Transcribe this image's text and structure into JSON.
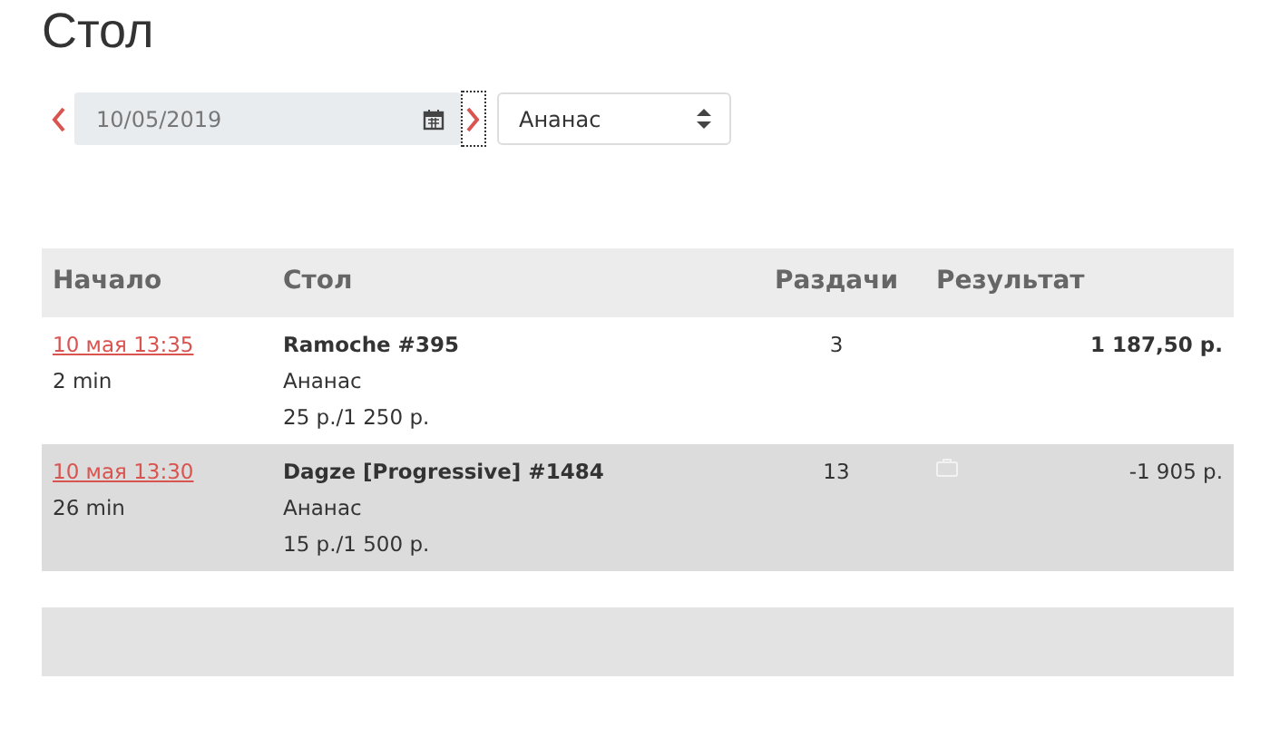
{
  "title": "Стол",
  "filter": {
    "date": "10/05/2019",
    "player": "Ананас"
  },
  "table": {
    "columns": [
      "Начало",
      "Стол",
      "Раздачи",
      "Результат"
    ],
    "rows": [
      {
        "start": "10 мая 13:35",
        "duration": "2 min",
        "table": "Ramoche #395",
        "player": "Ананас",
        "stakes": "25 р./1 250 р.",
        "hands": "3",
        "result": "1 187,50 р.",
        "result_bold": true,
        "shaded": false,
        "has_icon": false
      },
      {
        "start": "10 мая 13:30",
        "duration": "26 min",
        "table": "Dagze [Progressive] #1484",
        "player": "Ананас",
        "stakes": "15 р./1 500 р.",
        "hands": "13",
        "result": "-1 905 р.",
        "result_bold": false,
        "shaded": true,
        "has_icon": true
      }
    ]
  }
}
